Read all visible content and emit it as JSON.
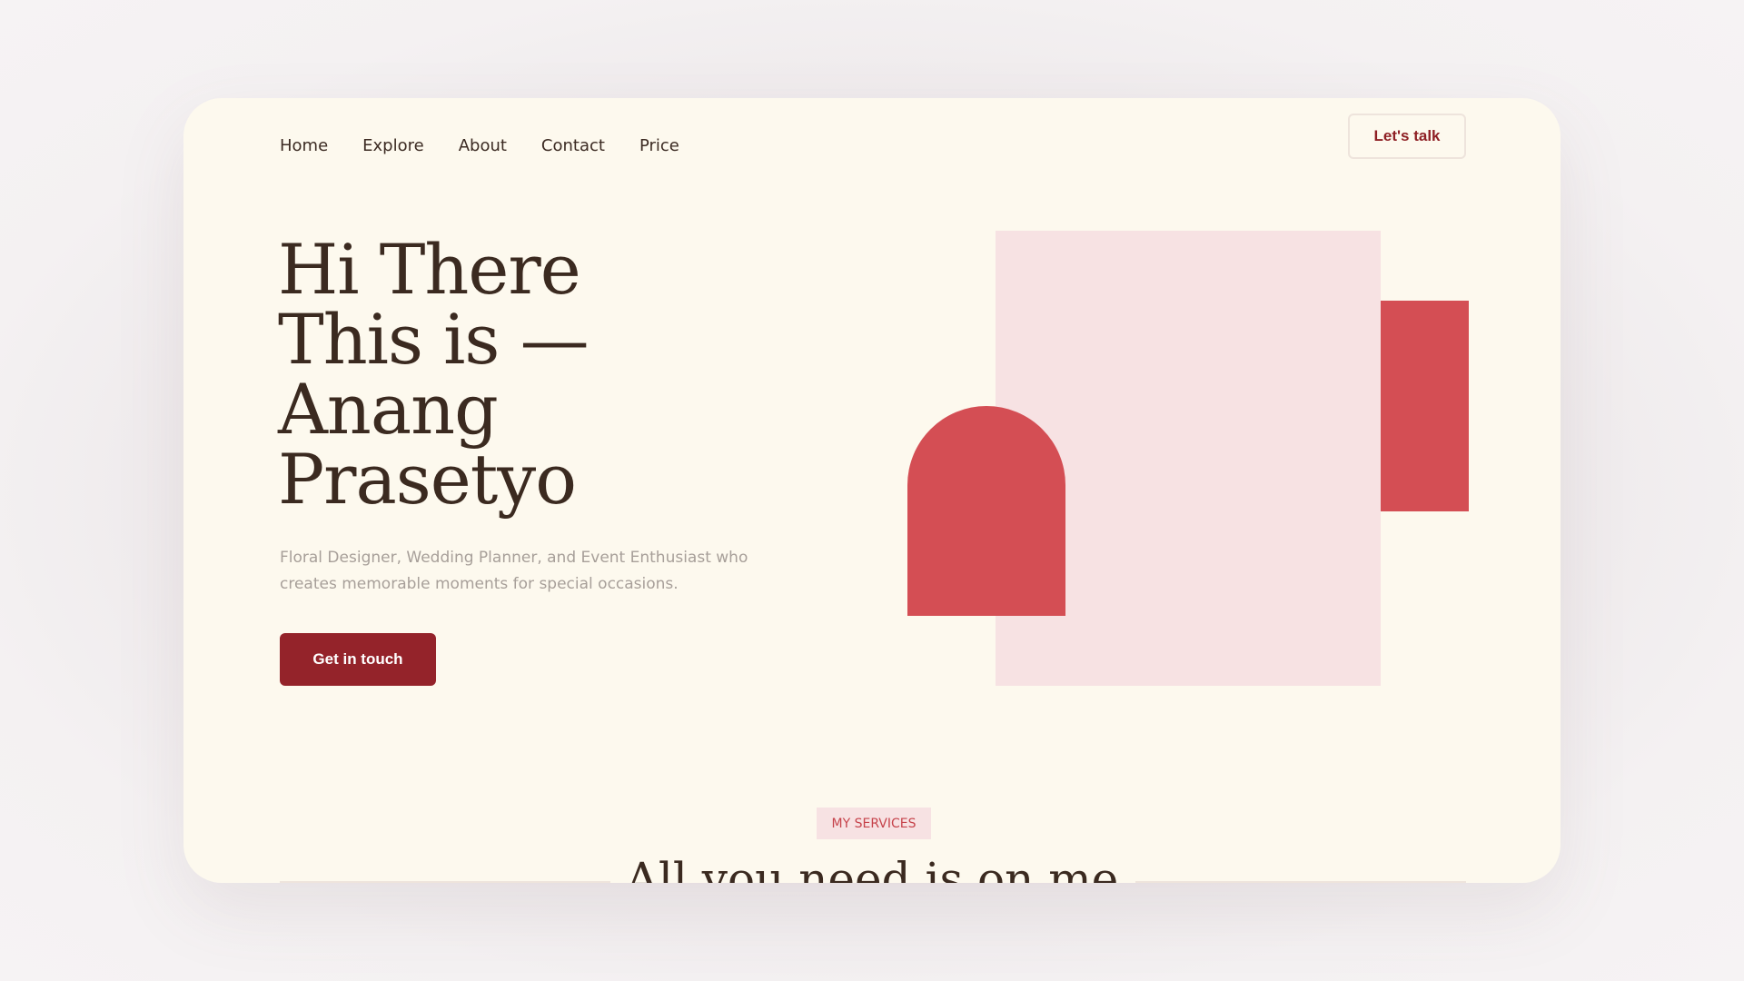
{
  "nav": {
    "items": [
      {
        "label": "Home"
      },
      {
        "label": "Explore"
      },
      {
        "label": "About"
      },
      {
        "label": "Contact"
      },
      {
        "label": "Price"
      }
    ],
    "cta_label": "Let's talk"
  },
  "hero": {
    "title_lines": [
      "Hi There",
      "This is —",
      "Anang",
      "Prasetyo"
    ],
    "subtitle": "Floral Designer, Wedding Planner, and Event Enthusiast who creates memorable moments for special occasions.",
    "button_label": "Get in touch"
  },
  "services": {
    "tag": "MY SERVICES",
    "title": "All you need is on me"
  },
  "colors": {
    "card_background": "#fdf9ee",
    "accent_dark_red": "#94232a",
    "accent_red": "#d44e54",
    "accent_pink": "#f7e2e3",
    "text_dark": "#3b2a20",
    "text_muted": "#a79f99"
  }
}
